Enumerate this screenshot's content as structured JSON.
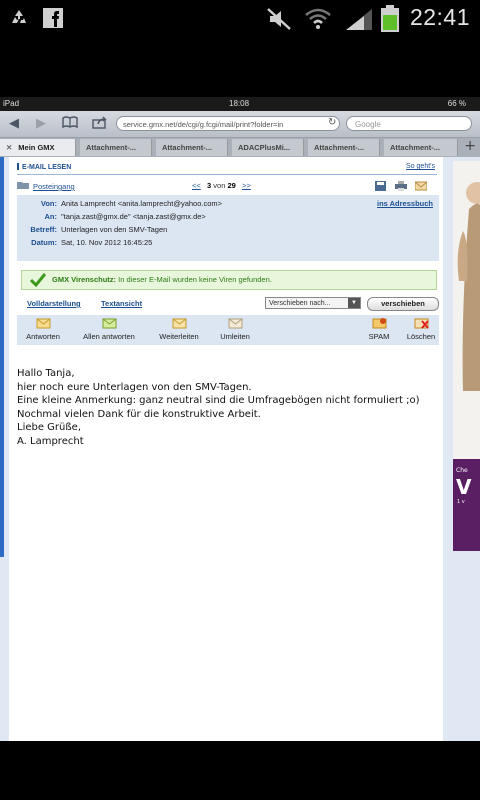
{
  "status_bar": {
    "left_icons": [
      "recycle-icon",
      "facebook-icon"
    ],
    "right_icons": [
      "mute-icon",
      "wifi-icon",
      "signal-icon",
      "battery-icon"
    ],
    "time": "22:41"
  },
  "ipad_status": {
    "device": "iPad",
    "time": "18:08",
    "battery": "66 %"
  },
  "browser": {
    "url": "service.gmx.net/de/cgi/g.fcgi/mail/print?folder=in",
    "search_placeholder": "Google",
    "tabs": [
      {
        "label": "Mein GMX",
        "active": true
      },
      {
        "label": "Attachment-...",
        "active": false
      },
      {
        "label": "Attachment-...",
        "active": false
      },
      {
        "label": "ADACPlusMi...",
        "active": false
      },
      {
        "label": "Attachment-...",
        "active": false
      },
      {
        "label": "Attachment-...",
        "active": false
      }
    ]
  },
  "mail_page": {
    "section_title": "E-MAIL LESEN",
    "help_link": "So geht's",
    "folder": "Posteingang",
    "pager": {
      "prev": "<<",
      "current": "3",
      "of": "von",
      "total": "29",
      "next": ">>"
    },
    "headers": {
      "von_label": "Von:",
      "von": "Anita Lamprecht <anita.lamprecht@yahoo.com>",
      "address_book": "ins Adressbuch",
      "an_label": "An:",
      "an": "\"tanja.zast@gmx.de\" <tanja.zast@gmx.de>",
      "betreff_label": "Betreff:",
      "betreff": "Unterlagen von den SMV-Tagen",
      "datum_label": "Datum:",
      "datum": "Sat, 10. Nov 2012 16:45:25"
    },
    "virus": {
      "title": "GMX Virenschutz:",
      "message": "In dieser E-Mail wurden keine Viren gefunden."
    },
    "view_links": {
      "full": "Volldarstellung",
      "text": "Textansicht"
    },
    "move": {
      "select": "Verschieben nach...",
      "button": "verschieben"
    },
    "actions": {
      "reply": "Antworten",
      "reply_all": "Allen antworten",
      "forward": "Weiterleiten",
      "redirect": "Umleiten",
      "spam": "SPAM",
      "delete": "Löschen"
    },
    "body": [
      "Hallo Tanja,",
      "",
      "hier noch eure Unterlagen von den SMV-Tagen.",
      "Eine kleine Anmerkung: ganz neutral sind die Umfragebögen nicht formuliert ;o)",
      "",
      "Nochmal vielen Dank für die konstruktive Arbeit.",
      "Liebe Grüße,",
      "A. Lamprecht"
    ]
  },
  "ad_text": {
    "top": "Che",
    "big": "V",
    "small": "1 v"
  }
}
